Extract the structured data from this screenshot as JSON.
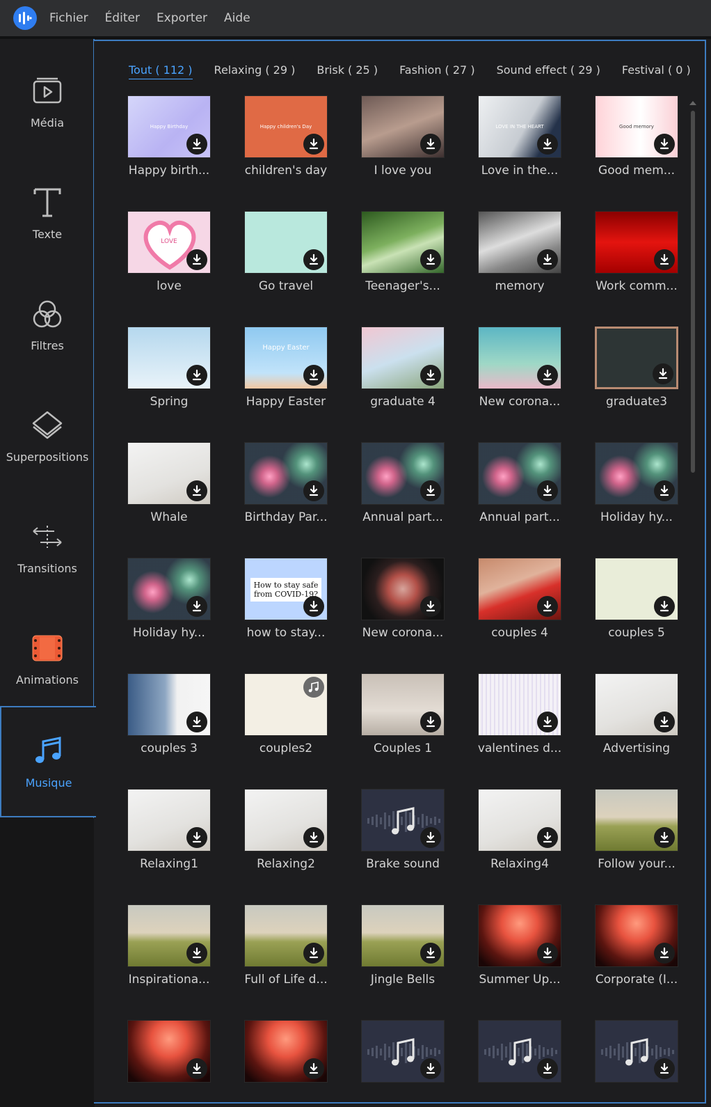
{
  "menubar": {
    "items": [
      "Fichier",
      "Éditer",
      "Exporter",
      "Aide"
    ]
  },
  "sidebar": {
    "items": [
      {
        "label": "Média",
        "icon": "media-icon"
      },
      {
        "label": "Texte",
        "icon": "text-icon"
      },
      {
        "label": "Filtres",
        "icon": "filters-icon"
      },
      {
        "label": "Superpositions",
        "icon": "overlays-icon"
      },
      {
        "label": "Transitions",
        "icon": "transitions-icon"
      },
      {
        "label": "Animations",
        "icon": "animations-icon"
      },
      {
        "label": "Musique",
        "icon": "music-icon",
        "active": true
      }
    ]
  },
  "tabs": [
    {
      "label": "Tout ( 112 )",
      "active": true
    },
    {
      "label": "Relaxing ( 29 )"
    },
    {
      "label": "Brisk ( 25 )"
    },
    {
      "label": "Fashion ( 27 )"
    },
    {
      "label": "Sound effect ( 29 )"
    },
    {
      "label": "Festival ( 0 )"
    }
  ],
  "items": [
    {
      "title": "Happy birth...",
      "thumb": "birthday",
      "caption": "Happy Birthday"
    },
    {
      "title": "children's day",
      "thumb": "children",
      "caption": "Happy children's Day"
    },
    {
      "title": "I love you",
      "thumb": "iloveyou"
    },
    {
      "title": "Love in the...",
      "thumb": "loveheart",
      "caption": "LOVE IN THE HEART"
    },
    {
      "title": "Good mem...",
      "thumb": "goodmemory",
      "caption": "Good memory"
    },
    {
      "title": "love",
      "thumb": "loveframe",
      "caption": "LOVE"
    },
    {
      "title": "Go travel",
      "thumb": "gotravel"
    },
    {
      "title": "Teenager's...",
      "thumb": "teenager"
    },
    {
      "title": "memory",
      "thumb": "memory"
    },
    {
      "title": "Work comm...",
      "thumb": "work"
    },
    {
      "title": "Spring",
      "thumb": "spring"
    },
    {
      "title": "Happy Easter",
      "thumb": "easter",
      "caption": "Happy Easter"
    },
    {
      "title": "graduate 4",
      "thumb": "graduate4"
    },
    {
      "title": "New corona...",
      "thumb": "corona1"
    },
    {
      "title": "graduate3",
      "thumb": "graduate3"
    },
    {
      "title": "Whale",
      "thumb": "flowers"
    },
    {
      "title": "Birthday Par...",
      "thumb": "fireworks"
    },
    {
      "title": "Annual part...",
      "thumb": "fireworks"
    },
    {
      "title": "Annual part...",
      "thumb": "fireworks"
    },
    {
      "title": "Holiday hy...",
      "thumb": "fireworks"
    },
    {
      "title": "Holiday hy...",
      "thumb": "fireworks"
    },
    {
      "title": "how to stay...",
      "thumb": "covidnote",
      "caption": "How to stay safe from COVID-19?"
    },
    {
      "title": "New corona...",
      "thumb": "virus"
    },
    {
      "title": "couples 4",
      "thumb": "couples4"
    },
    {
      "title": "couples 5",
      "thumb": "couples5"
    },
    {
      "title": "couples 3",
      "thumb": "couples3"
    },
    {
      "title": "couples2",
      "thumb": "couples2",
      "music": true
    },
    {
      "title": "Couples 1",
      "thumb": "couples1"
    },
    {
      "title": "valentines d...",
      "thumb": "valentines"
    },
    {
      "title": "Advertising",
      "thumb": "flowers"
    },
    {
      "title": "Relaxing1",
      "thumb": "flowers"
    },
    {
      "title": "Relaxing2",
      "thumb": "flowers"
    },
    {
      "title": "Brake sound",
      "thumb": "audio"
    },
    {
      "title": "Relaxing4",
      "thumb": "flowers"
    },
    {
      "title": "Follow your...",
      "thumb": "field"
    },
    {
      "title": "Inspirationa...",
      "thumb": "field"
    },
    {
      "title": "Full of Life d...",
      "thumb": "field"
    },
    {
      "title": "Jingle Bells",
      "thumb": "field"
    },
    {
      "title": "Summer Up...",
      "thumb": "concert"
    },
    {
      "title": "Corporate (I...",
      "thumb": "concert"
    },
    {
      "title": "",
      "thumb": "concert"
    },
    {
      "title": "",
      "thumb": "concert"
    },
    {
      "title": "",
      "thumb": "audio"
    },
    {
      "title": "",
      "thumb": "audio"
    },
    {
      "title": "",
      "thumb": "audio"
    }
  ],
  "colors": {
    "accent": "#4aa3ff",
    "border": "#3d7cc0",
    "background": "#1d1d1f",
    "menubar": "#2e2f31"
  }
}
